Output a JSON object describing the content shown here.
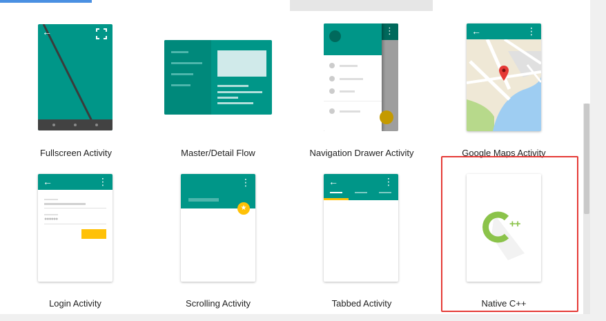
{
  "templates": [
    {
      "name": "Fullscreen Activity"
    },
    {
      "name": "Master/Detail Flow"
    },
    {
      "name": "Navigation Drawer Activity"
    },
    {
      "name": "Google Maps Activity"
    },
    {
      "name": "Login Activity"
    },
    {
      "name": "Scrolling Activity"
    },
    {
      "name": "Tabbed Activity"
    },
    {
      "name": "Native C++"
    }
  ],
  "colors": {
    "teal": "#009688",
    "dark_teal": "#00796b",
    "accent_yellow": "#ffc107",
    "selection_red": "#e53935",
    "cpp_green": "#8bc34a"
  },
  "icons": {
    "back": "arrow-left",
    "menu": "vertical-ellipsis",
    "fullscreen": "expand-corners",
    "map_pin": "location-pin",
    "fab_star": "star",
    "cpp_logo": "c-plus-plus"
  },
  "cpp_logo_text": "++"
}
